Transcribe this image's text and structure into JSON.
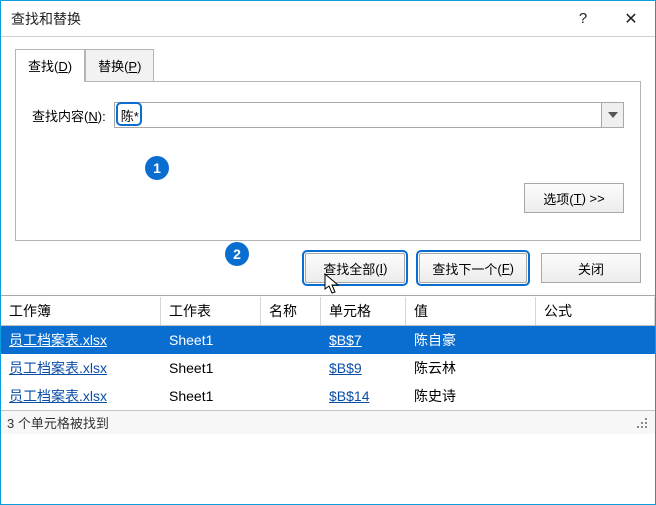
{
  "title": "查找和替换",
  "titlebar": {
    "help": "?",
    "close": "✕"
  },
  "tabs": {
    "find_pre": "查找(",
    "find_u": "D",
    "find_post": ")",
    "replace_pre": "替换(",
    "replace_u": "P",
    "replace_post": ")"
  },
  "search": {
    "label_pre": "查找内容(",
    "label_u": "N",
    "label_post": "):",
    "value": "陈*"
  },
  "options": {
    "label_pre": "选项(",
    "label_u": "T",
    "label_post": ") >>"
  },
  "buttons": {
    "find_all_pre": "查找全部(",
    "find_all_u": "I",
    "find_all_post": ")",
    "find_next_pre": "查找下一个(",
    "find_next_u": "F",
    "find_next_post": ")",
    "close": "关闭"
  },
  "callouts": {
    "one": "1",
    "two": "2"
  },
  "results": {
    "headers": [
      "工作簿",
      "工作表",
      "名称",
      "单元格",
      "值",
      "公式"
    ],
    "rows": [
      {
        "workbook": "员工档案表.xlsx",
        "sheet": "Sheet1",
        "name": "",
        "cell": "$B$7",
        "value": "陈自豪",
        "formula": "",
        "selected": true
      },
      {
        "workbook": "员工档案表.xlsx",
        "sheet": "Sheet1",
        "name": "",
        "cell": "$B$9",
        "value": "陈云林",
        "formula": "",
        "selected": false
      },
      {
        "workbook": "员工档案表.xlsx",
        "sheet": "Sheet1",
        "name": "",
        "cell": "$B$14",
        "value": "陈史诗",
        "formula": "",
        "selected": false
      }
    ]
  },
  "status": "3 个单元格被找到"
}
